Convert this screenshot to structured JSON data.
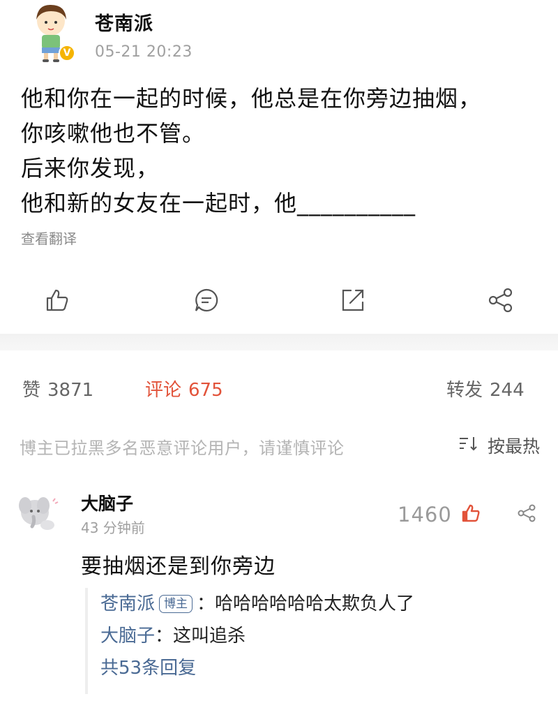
{
  "post": {
    "username": "苍南派",
    "timestamp": "05-21 20:23",
    "lines": [
      "他和你在一起的时候，他总是在你旁边抽烟，",
      "你咳嗽他也不管。",
      "后来你发现，",
      "他和新的女友在一起时，他__________"
    ],
    "translate_label": "查看翻译",
    "verified_icon": "verified-v-icon"
  },
  "actions": {
    "icons": [
      "like-icon",
      "comment-icon",
      "repost-icon",
      "share-icon"
    ]
  },
  "stats": {
    "likes_label": "赞",
    "likes": "3871",
    "comments_label": "评论",
    "comments": "675",
    "reposts_label": "转发",
    "reposts": "244",
    "comments_color": "#e2533a"
  },
  "notice": "博主已拉黑多名恶意评论用户，请谨慎评论",
  "sort": {
    "label": "按最热",
    "icon": "sort-icon"
  },
  "comment": {
    "username": "大脑子",
    "time": "43 分钟前",
    "likes": "1460",
    "text": "要抽烟还是到你旁边",
    "like_icon_color": "#e2533a",
    "replies": [
      {
        "user": "苍南派",
        "badge": "博主",
        "text": "：哈哈哈哈哈哈太欺负人了"
      },
      {
        "user": "大脑子",
        "badge": "",
        "text": "：这叫追杀"
      }
    ],
    "more": "共53条回复"
  }
}
